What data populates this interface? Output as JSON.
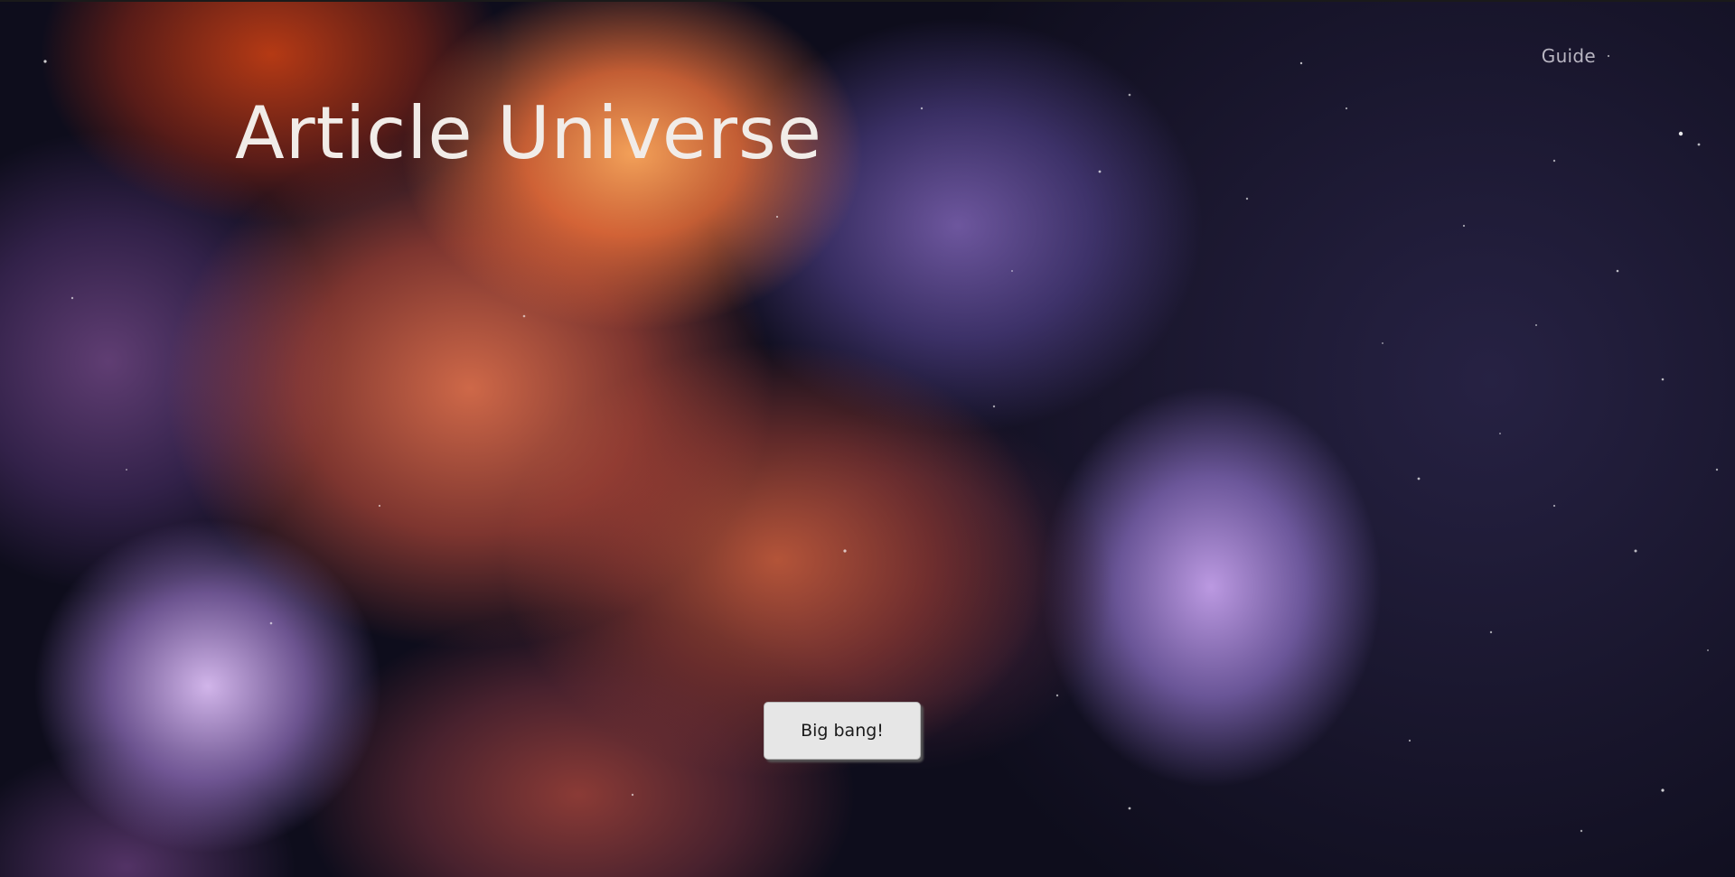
{
  "header": {
    "title": "Article Universe",
    "nav": {
      "guide_label": "Guide"
    }
  },
  "hero": {
    "button_label": "Big bang!"
  },
  "background": {
    "description_colors": {
      "nebula_orange": "#ff9a5c",
      "nebula_purple": "#9a7ad2",
      "space_dark": "#0f0e1d"
    }
  }
}
